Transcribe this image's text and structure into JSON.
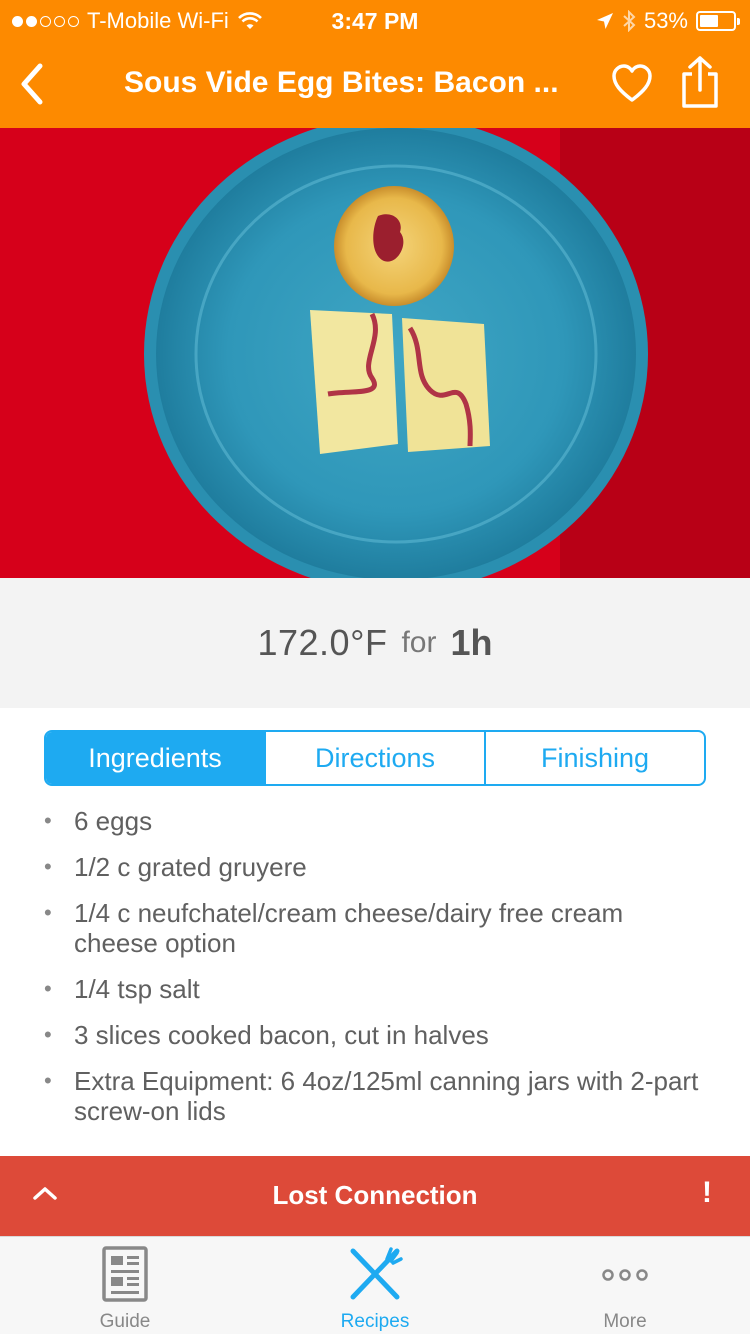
{
  "status_bar": {
    "carrier": "T-Mobile Wi-Fi",
    "time": "3:47 PM",
    "battery": "53%"
  },
  "nav": {
    "title": "Sous Vide Egg Bites: Bacon ..."
  },
  "cook": {
    "temperature": "172.0°F",
    "for_label": "for",
    "duration": "1h"
  },
  "tabs": [
    {
      "label": "Ingredients",
      "active": true
    },
    {
      "label": "Directions",
      "active": false
    },
    {
      "label": "Finishing",
      "active": false
    }
  ],
  "ingredients": [
    "6 eggs",
    "1/2 c grated gruyere",
    "1/4 c neufchatel/cream cheese/dairy free cream cheese option",
    "1/4 tsp salt",
    "3 slices cooked bacon, cut in halves",
    "Extra Equipment: 6 4oz/125ml canning jars with 2-part screw-on lids"
  ],
  "banner": {
    "message": "Lost Connection",
    "alert": "!"
  },
  "tabbar": [
    {
      "label": "Guide",
      "icon": "guide-icon"
    },
    {
      "label": "Recipes",
      "icon": "recipes-icon",
      "active": true
    },
    {
      "label": "More",
      "icon": "more-icon"
    }
  ],
  "colors": {
    "header": "#fd8a00",
    "accent": "#1eaaf1",
    "banner": "#dd4a39"
  }
}
